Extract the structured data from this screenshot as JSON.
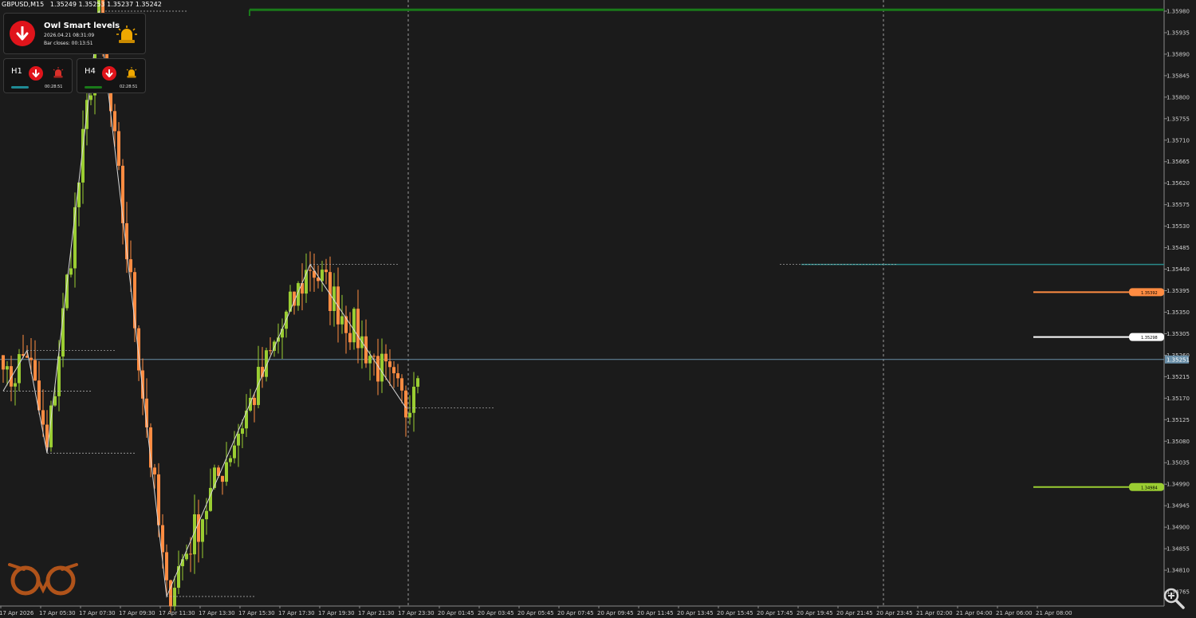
{
  "header": {
    "symbol_tf": "GBPUSD,M15",
    "ohlc": "1.35249 1.35253 1.35237 1.35242"
  },
  "panel_main": {
    "title": "Owl Smart levels",
    "datetime": "2026.04.21 08:31:09",
    "bar_closes": "Bar closes: 00:13:51"
  },
  "panel_h1": {
    "label": "H1",
    "timer": "00:28:51"
  },
  "panel_h4": {
    "label": "H4",
    "timer": "02:28:51"
  },
  "icons": {
    "main_arrow": "arrow-down-icon",
    "siren": "siren-icon",
    "logo": "owl-logo-icon",
    "zoom": "zoom-icon"
  },
  "colors": {
    "background": "#1b1b1b",
    "bull": "#9acd32",
    "bear": "#ff8c42",
    "zigzag": "#d8d8d8",
    "resistance": "#1a7a1a",
    "teal": "#2a8a8a",
    "price_line": "#6a8fa8",
    "red_icon": "#e0141b"
  },
  "chart_data": {
    "type": "candlestick",
    "symbol": "GBPUSD",
    "timeframe": "M15",
    "ylim": [
      1.34735,
      1.35995
    ],
    "y_ticks": [
      "1.35980",
      "1.35935",
      "1.35890",
      "1.35845",
      "1.35800",
      "1.35755",
      "1.35710",
      "1.35665",
      "1.35620",
      "1.35575",
      "1.35530",
      "1.35485",
      "1.35440",
      "1.35395",
      "1.35350",
      "1.35305",
      "1.35260",
      "1.35215",
      "1.35170",
      "1.35125",
      "1.35080",
      "1.35035",
      "1.34990",
      "1.34945",
      "1.34900",
      "1.34855",
      "1.34810",
      "1.34765"
    ],
    "x_labels": [
      "17 Apr 2026",
      "17 Apr 05:30",
      "17 Apr 07:30",
      "17 Apr 09:30",
      "17 Apr 11:30",
      "17 Apr 13:30",
      "17 Apr 15:30",
      "17 Apr 17:30",
      "17 Apr 19:30",
      "17 Apr 21:30",
      "17 Apr 23:30",
      "20 Apr 01:45",
      "20 Apr 03:45",
      "20 Apr 05:45",
      "20 Apr 07:45",
      "20 Apr 09:45",
      "20 Apr 11:45",
      "20 Apr 13:45",
      "20 Apr 15:45",
      "20 Apr 17:45",
      "20 Apr 19:45",
      "20 Apr 21:45",
      "20 Apr 23:45",
      "21 Apr 02:00",
      "21 Apr 04:00",
      "21 Apr 06:00",
      "21 Apr 08:00"
    ],
    "current_price": "1.35251",
    "current_price_value": 1.35251,
    "levels": [
      {
        "name": "resistance-top",
        "value": 1.35983,
        "color": "#1a7a1a"
      },
      {
        "name": "teal-level",
        "value": 1.3545,
        "color": "#2a8a8a"
      },
      {
        "name": "orange-level",
        "value": 1.35392,
        "label": "1.35392",
        "color": "#ff8c42"
      },
      {
        "name": "white-level",
        "value": 1.35298,
        "label": "1.35298",
        "color": "#ffffff"
      },
      {
        "name": "green-level",
        "value": 1.34984,
        "label": "1.34984",
        "color": "#9acd32"
      }
    ],
    "key_points": [
      {
        "t": 0,
        "p": 1.35185
      },
      {
        "t": 6,
        "p": 1.3527
      },
      {
        "t": 11,
        "p": 1.35055
      },
      {
        "t": 24,
        "p": 1.3598
      },
      {
        "t": 41,
        "p": 1.34755
      },
      {
        "t": 77,
        "p": 1.3545
      },
      {
        "t": 101,
        "p": 1.3515
      },
      {
        "t": 104,
        "p": 1.3525
      }
    ],
    "zigzag": [
      {
        "t": 0,
        "p": 1.35185
      },
      {
        "t": 6,
        "p": 1.3527
      },
      {
        "t": 11,
        "p": 1.35055
      },
      {
        "t": 24,
        "p": 1.3598
      },
      {
        "t": 41,
        "p": 1.34755
      },
      {
        "t": 77,
        "p": 1.3545
      },
      {
        "t": 101,
        "p": 1.3515
      }
    ]
  }
}
